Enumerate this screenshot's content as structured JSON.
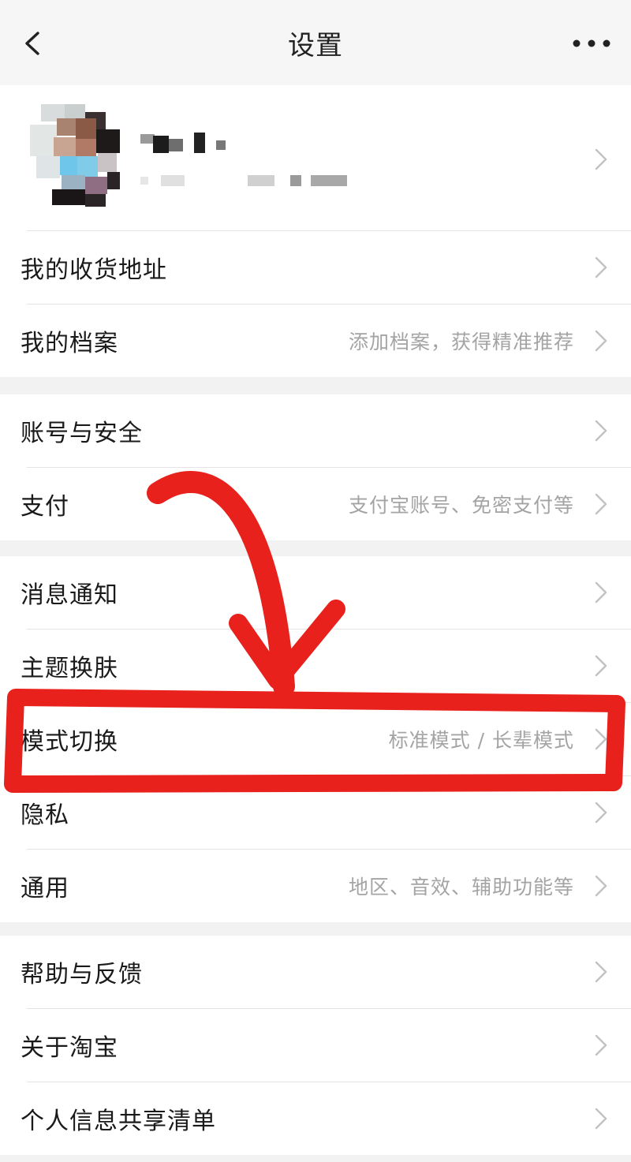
{
  "nav": {
    "title": "设置"
  },
  "groups": [
    {
      "rows": [
        {
          "label": "我的收货地址",
          "hint": ""
        },
        {
          "label": "我的档案",
          "hint": "添加档案，获得精准推荐"
        }
      ]
    },
    {
      "rows": [
        {
          "label": "账号与安全",
          "hint": ""
        },
        {
          "label": "支付",
          "hint": "支付宝账号、免密支付等"
        }
      ]
    },
    {
      "rows": [
        {
          "label": "消息通知",
          "hint": ""
        },
        {
          "label": "主题换肤",
          "hint": ""
        },
        {
          "label": "模式切换",
          "hint": "标准模式 / 长辈模式"
        },
        {
          "label": "隐私",
          "hint": ""
        },
        {
          "label": "通用",
          "hint": "地区、音效、辅助功能等"
        }
      ]
    },
    {
      "rows": [
        {
          "label": "帮助与反馈",
          "hint": ""
        },
        {
          "label": "关于淘宝",
          "hint": ""
        },
        {
          "label": "个人信息共享清单",
          "hint": ""
        }
      ]
    }
  ],
  "icons": {
    "back": "chevron-left-icon",
    "more": "more-dots-icon",
    "chevron": "chevron-right-icon"
  },
  "colors": {
    "annotation": "#e8211c",
    "hint_text": "#a4a4a4",
    "page_bg": "#f2f2f2"
  }
}
